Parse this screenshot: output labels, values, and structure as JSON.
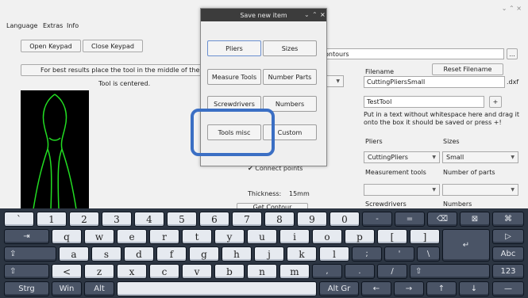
{
  "window": {
    "controls": "⌄  ⌃  ×"
  },
  "menu": [
    "Language",
    "Extras",
    "Info"
  ],
  "left": {
    "open_keypad": "Open Keypad",
    "close_keypad": "Close Keypad",
    "hint": "For best results place the tool in the middle of the plate",
    "status": "Tool is centered."
  },
  "dialog": {
    "title": "Save new item",
    "controls": [
      "⌄",
      "⌃",
      "×"
    ],
    "buttons": [
      "Pliers",
      "Sizes",
      "Measure Tools",
      "Number Parts",
      "Screwdrivers",
      "Numbers",
      "Tools misc",
      "Custom"
    ]
  },
  "middle": {
    "contours_partial": "ontours",
    "connect_points": "✔ Connect points",
    "thickness_label": "Thickness:",
    "thickness_value": "15mm",
    "get_contour": "Get Contour"
  },
  "right": {
    "browse": "...",
    "filename_label": "Filename",
    "reset_filename": "Reset Filename",
    "filename_value": "CuttingPliersSmall",
    "ext": ".dxf",
    "tool_name": "TestTool",
    "plus": "+",
    "help": "Put in a text without whitespace here and drag it onto the box it should be saved or press +!",
    "pliers_label": "Pliers",
    "sizes_label": "Sizes",
    "pliers_value": "CuttingPliers",
    "sizes_value": "Small",
    "measurement_tools_label": "Measurement tools",
    "number_parts_label": "Number of parts",
    "screwdrivers_label": "Screwdrivers",
    "numbers_label": "Numbers"
  },
  "keyboard": {
    "row1": [
      "`",
      "1",
      "2",
      "3",
      "4",
      "5",
      "6",
      "7",
      "8",
      "9",
      "0",
      "-",
      "=",
      "⌫",
      "⊠",
      "⌘"
    ],
    "row2": [
      "⇥",
      "q",
      "w",
      "e",
      "r",
      "t",
      "y",
      "u",
      "i",
      "o",
      "p",
      "[",
      "]",
      "↵",
      "▷"
    ],
    "row3": [
      "⇪",
      "a",
      "s",
      "d",
      "f",
      "g",
      "h",
      "j",
      "k",
      "l",
      ";",
      "'",
      "\\",
      "Abc"
    ],
    "row4": [
      "⇧",
      "<",
      "z",
      "x",
      "c",
      "v",
      "b",
      "n",
      "m",
      ",",
      ".",
      "/",
      "⇧",
      "123"
    ],
    "row5": [
      "Strg",
      "Win",
      "Alt",
      "",
      "Alt Gr",
      "←",
      "→",
      "↑",
      "↓",
      "—"
    ]
  },
  "colors": {
    "highlight": "#3b6fc4",
    "outline": "#22dd22",
    "keyboard_bg": "#2c3542"
  }
}
